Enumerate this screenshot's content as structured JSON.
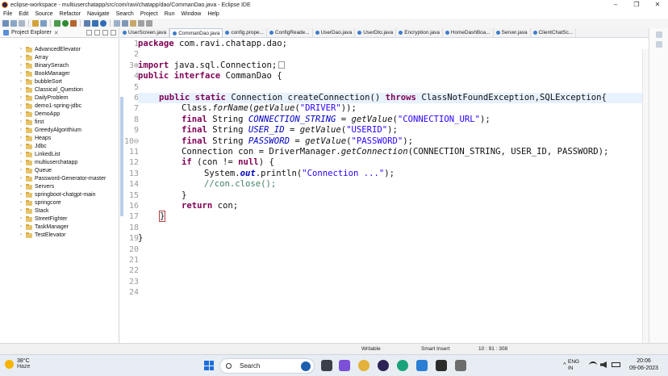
{
  "window": {
    "title": "eclipse-workspace - multiuserchatapp/src/com/ravi/chatapp/dao/CommanDao.java - Eclipse IDE"
  },
  "menu": [
    "File",
    "Edit",
    "Source",
    "Refactor",
    "Navigate",
    "Search",
    "Project",
    "Run",
    "Window",
    "Help"
  ],
  "project_explorer": {
    "label": "Project Explorer",
    "projects": [
      "AdvancedElevator",
      "Array",
      "BinarySerach",
      "BookManager",
      "bubbleSort",
      "Classical_Question",
      "DailyProblem",
      "demo1-spring-jdbc",
      "DemoApp",
      "first",
      "GreedyAlgorithium",
      "Heaps",
      "Jdbc",
      "LinkedList",
      "multiuserchatapp",
      "Queue",
      "Password-Generator-master",
      "Servers",
      "springboot-chatgpt-main",
      "springcore",
      "Stack",
      "StreetFighter",
      "TaskManager",
      "TestElevator"
    ]
  },
  "editor_tabs": [
    {
      "label": "UserScreen.java",
      "active": false
    },
    {
      "label": "CommanDao.java",
      "active": true
    },
    {
      "label": "config.prope...",
      "active": false
    },
    {
      "label": "ConfigReade...",
      "active": false
    },
    {
      "label": "UserDao.java",
      "active": false
    },
    {
      "label": "UserDto.java",
      "active": false
    },
    {
      "label": "Encryption.java",
      "active": false
    },
    {
      "label": "HomeDashBoa...",
      "active": false
    },
    {
      "label": "Server.java",
      "active": false
    },
    {
      "label": "ClientChatSc...",
      "active": false
    }
  ],
  "line_numbers": [
    "1",
    "2",
    "3⊕",
    "4",
    "5",
    "6",
    "7",
    "8",
    "9",
    "10⊖",
    "11",
    "12",
    "13",
    "14",
    "15",
    "16",
    "17",
    "18",
    "19",
    "20",
    "21",
    "22",
    "23",
    "24"
  ],
  "code": {
    "l1_kw": "package",
    "l1_rest": " com.ravi.chatapp.dao;",
    "l3_kw": "import",
    "l3_rest": " java.sql.Connection;",
    "l4_kw1": "public",
    "l4_kw2": "interface",
    "l4_rest": " CommanDao {",
    "l10_kw1": "public",
    "l10_kw2": "static",
    "l10_mid": " Connection createConnection() ",
    "l10_kw3": "throws",
    "l10_rest": " ClassNotFoundException,SQLException{",
    "l11_a": "Class.",
    "l11_m1": "forName",
    "l11_b": "(",
    "l11_m2": "getValue",
    "l11_c": "(",
    "l11_s": "\"DRIVER\"",
    "l11_d": "));",
    "l12_kw": "final",
    "l12_a": " String ",
    "l12_f": "CONNECTION_STRING",
    "l12_b": " = ",
    "l12_m": "getValue",
    "l12_c": "(",
    "l12_s": "\"CONNECTION_URL\"",
    "l12_d": ");",
    "l13_kw": "final",
    "l13_a": " String ",
    "l13_f": "USER_ID",
    "l13_b": " = ",
    "l13_m": "getValue",
    "l13_c": "(",
    "l13_s": "\"USERID\"",
    "l13_d": ");",
    "l14_kw": "final",
    "l14_a": " String ",
    "l14_f": "PASSWORD",
    "l14_b": " = ",
    "l14_m": "getValue",
    "l14_c": "(",
    "l14_s": "\"PASSWORD\"",
    "l14_d": ");",
    "l15_a": "Connection con = DriverManager.",
    "l15_m": "getConnection",
    "l15_b": "(CONNECTION_STRING, USER_ID, PASSWORD);",
    "l16_kw": "if",
    "l16_a": " (con != ",
    "l16_kw2": "null",
    "l16_b": ") {",
    "l17_a": "System.",
    "l17_f": "out",
    "l17_b": ".println(",
    "l17_s": "\"Connection ...\"",
    "l17_c": ");",
    "l18_cmt": "//con.close();",
    "l19": "}",
    "l20_kw": "return",
    "l20_rest": " con;",
    "l21": "}",
    "l23": "}"
  },
  "status": {
    "mode": "Writable",
    "insert": "Smart Insert",
    "position": "10 : 91 : 308"
  },
  "taskbar": {
    "weather_temp": "38°C",
    "weather_cond": "Haze",
    "search_placeholder": "Search",
    "lang1": "ENG",
    "lang2": "IN",
    "time": "20:06",
    "date": "09-06-2023"
  },
  "colors": {
    "keyword": "#7f0055",
    "field": "#0000c0",
    "string": "#2a00ff",
    "comment": "#3f7f5f",
    "current_line": "#e8f2fe"
  }
}
